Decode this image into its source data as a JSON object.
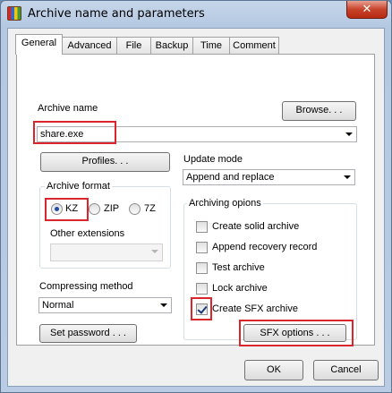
{
  "window": {
    "title": "Archive name and parameters",
    "close_glyph": "✕"
  },
  "tabs": [
    {
      "label": "General",
      "active": true
    },
    {
      "label": "Advanced"
    },
    {
      "label": "File"
    },
    {
      "label": "Backup"
    },
    {
      "label": "Time"
    },
    {
      "label": "Comment"
    }
  ],
  "archive_name": {
    "label": "Archive name",
    "value": "share.exe",
    "browse_label": "Browse. . ."
  },
  "profiles_label": "Profiles. . .",
  "update_mode": {
    "label": "Update mode",
    "value": "Append and replace"
  },
  "archive_format": {
    "label": "Archive format",
    "options": [
      {
        "label": "KZ",
        "checked": true
      },
      {
        "label": "ZIP",
        "checked": false
      },
      {
        "label": "7Z",
        "checked": false
      }
    ],
    "other_extensions_label": "Other extensions",
    "other_extensions_value": ""
  },
  "archiving_options": {
    "label": "Archiving opions",
    "items": [
      {
        "label": "Create solid archive",
        "checked": false
      },
      {
        "label": "Append recovery record",
        "checked": false
      },
      {
        "label": "Test archive",
        "checked": false
      },
      {
        "label": "Lock archive",
        "checked": false
      },
      {
        "label": "Create SFX archive",
        "checked": true
      }
    ],
    "sfx_options_label": "SFX options . . ."
  },
  "compressing_method": {
    "label": "Compressing method",
    "value": "Normal"
  },
  "set_password_label": "Set password . . .",
  "ok_label": "OK",
  "cancel_label": "Cancel",
  "colors": {
    "highlight": "#d9252b",
    "title_bar": "#b9cce4",
    "close_button": "#c7432b"
  },
  "icons": {
    "app": "archiver-app-icon",
    "close": "close-icon",
    "dropdown": "chevron-down-icon"
  }
}
